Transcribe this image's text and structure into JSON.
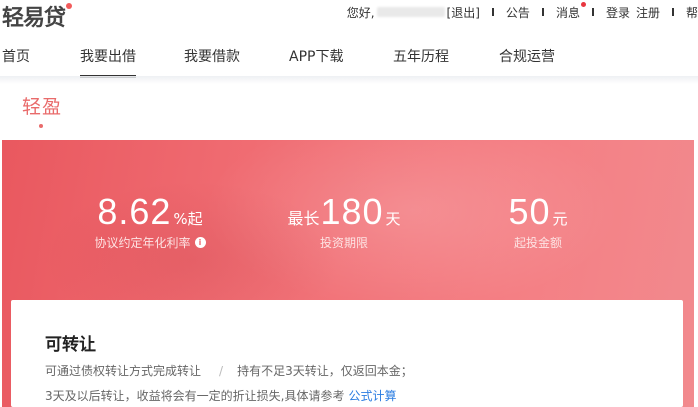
{
  "header": {
    "logo_text": "轻易贷",
    "greeting": "您好,",
    "logout": "[退出]",
    "links": [
      "公告",
      "消息",
      "登录",
      "注册",
      "帮"
    ]
  },
  "nav": {
    "items": [
      "首页",
      "我要出借",
      "我要借款",
      "APP下载",
      "五年历程",
      "合规运营"
    ],
    "active_index": 1
  },
  "product": {
    "title": "轻盈"
  },
  "hero": {
    "rate": {
      "value": "8.62",
      "unit": "%起",
      "label": "协议约定年化利率"
    },
    "term": {
      "prefix": "最长",
      "value": "180",
      "unit": "天",
      "label": "投资期限"
    },
    "min": {
      "value": "50",
      "unit": "元",
      "label": "起投金额"
    },
    "colors": {
      "start": "#e9585f",
      "end": "#f28a8e"
    }
  },
  "card": {
    "title": "可转让",
    "line1_a": "可通过债权转让方式完成转让",
    "separator": "/",
    "line1_b": "持有不足3天转让，仅返回本金；",
    "line2": "3天及以后转让，收益将会有一定的折让损失,具体请参考",
    "link": "公式计算"
  },
  "icons": {
    "info": "info-icon"
  }
}
